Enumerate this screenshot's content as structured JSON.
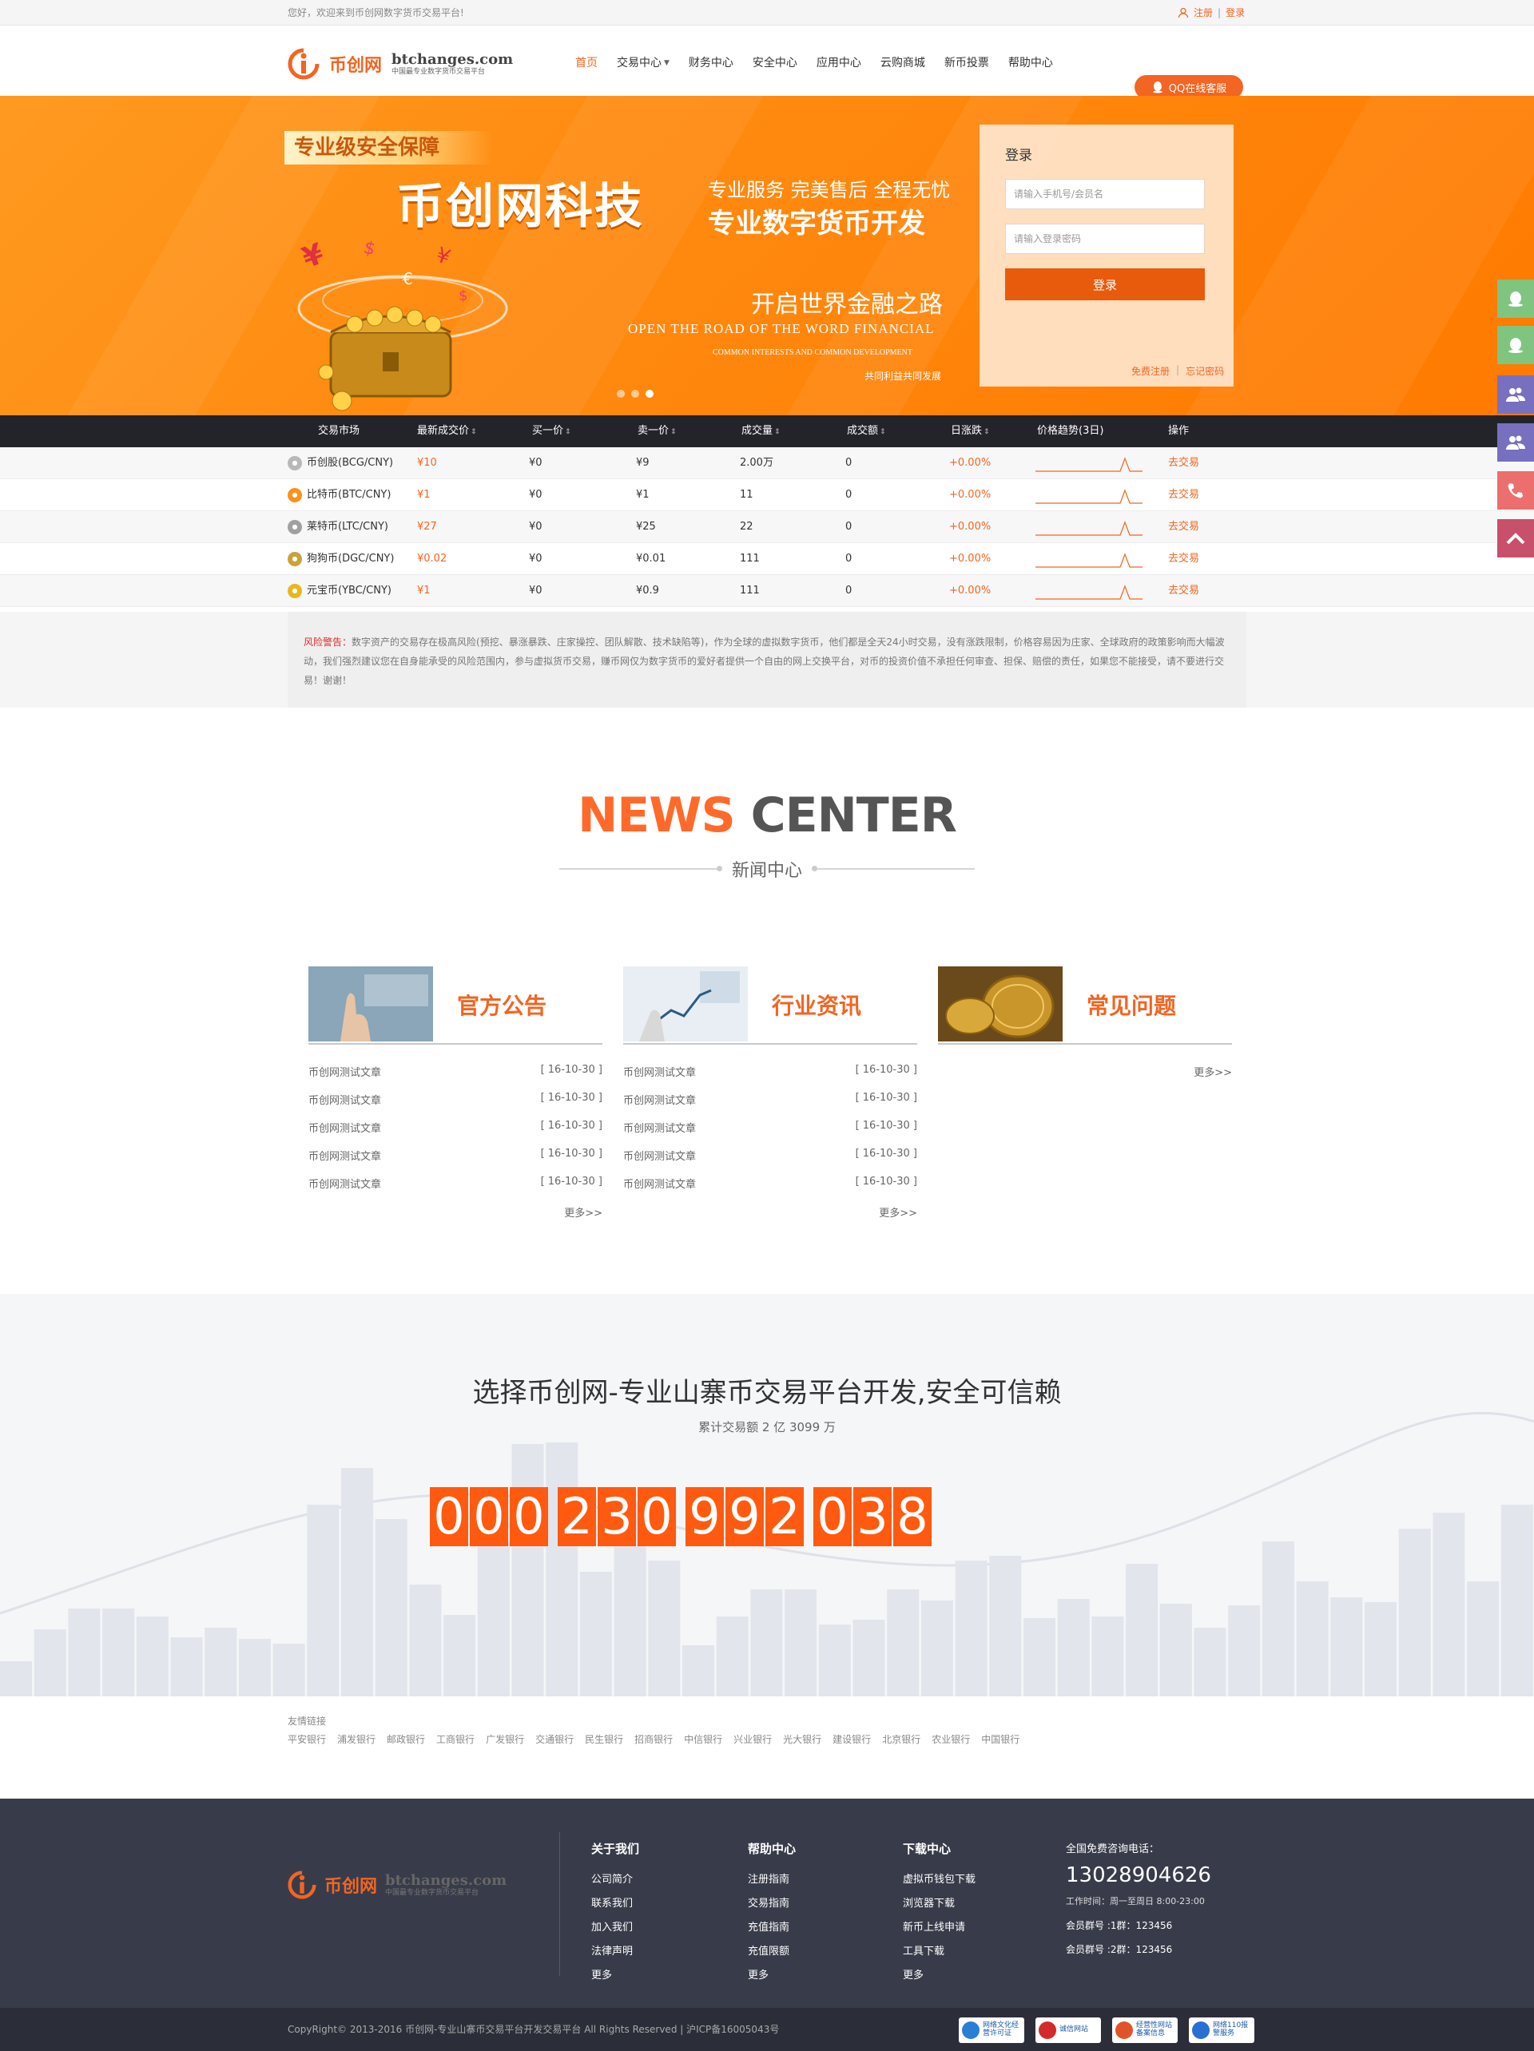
{
  "topbar": {
    "welcome": "您好，欢迎来到币创网数字货币交易平台!",
    "register": "注册",
    "sep": "|",
    "login": "登录"
  },
  "header": {
    "logo_cn": "币创网",
    "logo_domain": "btchanges.com",
    "logo_slogan": "中国最专业数字货币交易平台",
    "nav": [
      "首页",
      "交易中心",
      "财务中心",
      "安全中心",
      "应用中心",
      "云购商城",
      "新币投票",
      "帮助中心"
    ],
    "qq_button": "QQ在线客服"
  },
  "banner": {
    "tag": "专业级安全保障",
    "headline": "币创网科技",
    "sub1": "专业服务  完美售后  全程无忧",
    "sub2": "专业数字货币开发",
    "road": "开启世界金融之路",
    "road_en": "OPEN THE ROAD OF THE WORD FINANCIAL",
    "common_en": "COMMON INTERESTS AND COMMON DEVELOPMENT",
    "common_cn": "共同利益共同发展",
    "active_slide": 3
  },
  "login": {
    "title": "登录",
    "user_placeholder": "请输入手机号/会员名",
    "pass_placeholder": "请输入登录密码",
    "submit": "登录",
    "register": "免费注册",
    "sep": "|",
    "forgot": "忘记密码"
  },
  "market": {
    "headers": [
      "交易市场",
      "最新成交价",
      "买一价",
      "卖一价",
      "成交量",
      "成交额",
      "日涨跌",
      "价格趋势(3日)",
      "操作"
    ],
    "rows": [
      {
        "name": "币创股(BCG/CNY)",
        "price": "¥10",
        "buy": "¥0",
        "sell": "¥9",
        "volume": "2.00万",
        "amount": "0",
        "change": "+0.00%",
        "action": "去交易",
        "icon_color": "#b8b8b8"
      },
      {
        "name": "比特币(BTC/CNY)",
        "price": "¥1",
        "buy": "¥0",
        "sell": "¥1",
        "volume": "11",
        "amount": "0",
        "change": "+0.00%",
        "action": "去交易",
        "icon_color": "#f7931a"
      },
      {
        "name": "莱特币(LTC/CNY)",
        "price": "¥27",
        "buy": "¥0",
        "sell": "¥25",
        "volume": "22",
        "amount": "0",
        "change": "+0.00%",
        "action": "去交易",
        "icon_color": "#a0a0a0"
      },
      {
        "name": "狗狗币(DGC/CNY)",
        "price": "¥0.02",
        "buy": "¥0",
        "sell": "¥0.01",
        "volume": "111",
        "amount": "0",
        "change": "+0.00%",
        "action": "去交易",
        "icon_color": "#c9a23a"
      },
      {
        "name": "元宝币(YBC/CNY)",
        "price": "¥1",
        "buy": "¥0",
        "sell": "¥0.9",
        "volume": "111",
        "amount": "0",
        "change": "+0.00%",
        "action": "去交易",
        "icon_color": "#e6b820"
      }
    ]
  },
  "risk": {
    "label": "风险警告：",
    "text": "数字资产的交易存在极高风险(预挖、暴涨暴跌、庄家操控、团队解散、技术缺陷等)，作为全球的虚拟数字货币，他们都是全天24小时交易，没有涨跌限制，价格容易因为庄家、全球政府的政策影响而大幅波动，我们强烈建议您在自身能承受的风险范围内，参与虚拟货币交易，赚币网仅为数字货币的爱好者提供一个自由的网上交换平台，对币的投资价值不承担任何审查、担保、赔偿的责任，如果您不能接受，请不要进行交易！谢谢！"
  },
  "news": {
    "title_a": "NEWS",
    "title_b": "CENTER",
    "title_cn": "新闻中心",
    "columns": [
      {
        "heading": "官方公告",
        "items": [
          {
            "title": "币创网测试文章",
            "date": "[ 16-10-30 ]"
          },
          {
            "title": "币创网测试文章",
            "date": "[ 16-10-30 ]"
          },
          {
            "title": "币创网测试文章",
            "date": "[ 16-10-30 ]"
          },
          {
            "title": "币创网测试文章",
            "date": "[ 16-10-30 ]"
          },
          {
            "title": "币创网测试文章",
            "date": "[ 16-10-30 ]"
          }
        ],
        "more": "更多>>"
      },
      {
        "heading": "行业资讯",
        "items": [
          {
            "title": "币创网测试文章",
            "date": "[ 16-10-30 ]"
          },
          {
            "title": "币创网测试文章",
            "date": "[ 16-10-30 ]"
          },
          {
            "title": "币创网测试文章",
            "date": "[ 16-10-30 ]"
          },
          {
            "title": "币创网测试文章",
            "date": "[ 16-10-30 ]"
          },
          {
            "title": "币创网测试文章",
            "date": "[ 16-10-30 ]"
          }
        ],
        "more": "更多>>"
      },
      {
        "heading": "常见问题",
        "items": [],
        "more": "更多>>"
      }
    ]
  },
  "stats": {
    "title": "选择币创网-专业山寨币交易平台开发,安全可信赖",
    "subtitle": "累计交易额 2 亿 3099 万",
    "digit_groups": [
      "000",
      "230",
      "992",
      "038"
    ]
  },
  "friends": {
    "title": "友情链接",
    "links": [
      "平安银行",
      "浦发银行",
      "邮政银行",
      "工商银行",
      "广发银行",
      "交通银行",
      "民生银行",
      "招商银行",
      "中信银行",
      "兴业银行",
      "光大银行",
      "建设银行",
      "北京银行",
      "农业银行",
      "中国银行"
    ]
  },
  "footer": {
    "logo_cn": "币创网",
    "logo_domain": "btchanges.com",
    "logo_slogan": "中国最专业数字货币交易平台",
    "columns": [
      {
        "heading": "关于我们",
        "links": [
          "公司简介",
          "联系我们",
          "加入我们",
          "法律声明",
          "更多"
        ]
      },
      {
        "heading": "帮助中心",
        "links": [
          "注册指南",
          "交易指南",
          "充值指南",
          "充值限额",
          "更多"
        ]
      },
      {
        "heading": "下载中心",
        "links": [
          "虚拟币钱包下载",
          "浏览器下载",
          "新币上线申请",
          "工具下载",
          "更多"
        ]
      }
    ],
    "contact_title": "全国免费咨询电话：",
    "phone": "13028904626",
    "hours": "工作时间：周一至周日 8:00-23:00",
    "group1": "会员群号 :1群：123456",
    "group2": "会员群号 :2群：123456"
  },
  "copyright": {
    "text": "CopyRight© 2013-2016 币创网-专业山寨币交易平台开发交易平台 All Rights Reserved   |   沪ICP备16005043号",
    "badges": [
      {
        "label": "网络文化经营许可证",
        "color": "#2a7fd4"
      },
      {
        "label": "诚信网站",
        "color": "#d42a2a"
      },
      {
        "label": "经营性网站备案信息",
        "color": "#e0532a"
      },
      {
        "label": "网络110报警服务",
        "color": "#2a6fd4"
      }
    ]
  },
  "colors": {
    "accent": "#f26522",
    "banner": "#ff8a10",
    "dark": "#23242a",
    "footer": "#383c4a"
  },
  "side_icons": [
    "qq-icon",
    "qq-icon",
    "user-group-icon",
    "user-group-icon",
    "phone-icon",
    "back-to-top-icon"
  ]
}
